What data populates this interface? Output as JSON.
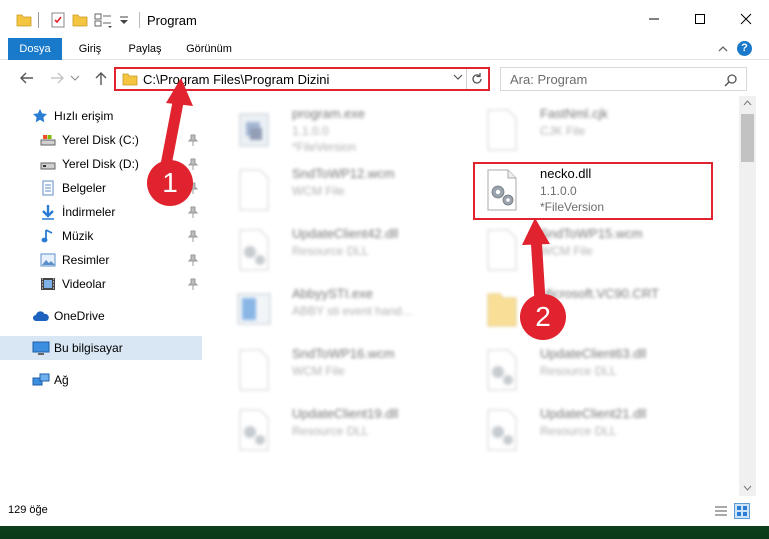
{
  "window": {
    "title": "Program"
  },
  "ribbon": {
    "tabs": [
      {
        "label": "Dosya"
      },
      {
        "label": "Giriş"
      },
      {
        "label": "Paylaş"
      },
      {
        "label": "Görünüm"
      }
    ],
    "help": "?"
  },
  "address": {
    "path": "C:\\Program Files\\Program Dizini",
    "search_placeholder": "Ara: Program"
  },
  "sidebar": {
    "items": [
      {
        "label": "Hızlı erişim",
        "icon": "star-icon"
      },
      {
        "label": "Yerel Disk (C:)",
        "icon": "drive-icon",
        "pinned": true
      },
      {
        "label": "Yerel Disk (D:)",
        "icon": "drive-icon",
        "pinned": true
      },
      {
        "label": "Belgeler",
        "icon": "documents-icon",
        "pinned": true
      },
      {
        "label": "İndirmeler",
        "icon": "download-icon",
        "pinned": true
      },
      {
        "label": "Müzik",
        "icon": "music-icon",
        "pinned": true
      },
      {
        "label": "Resimler",
        "icon": "pictures-icon",
        "pinned": true
      },
      {
        "label": "Videolar",
        "icon": "videos-icon",
        "pinned": true
      },
      {
        "label": "OneDrive",
        "icon": "onedrive-icon"
      },
      {
        "label": "Bu bilgisayar",
        "icon": "computer-icon",
        "selected": true
      },
      {
        "label": "Ağ",
        "icon": "network-icon"
      }
    ]
  },
  "files": [
    {
      "name": "program.exe",
      "desc": "1.1.0.0",
      "ver": "*FileVersion",
      "icon": "exe-icon",
      "blurred": true
    },
    {
      "name": "FastNml.cjk",
      "desc": "CJK File",
      "ver": "",
      "icon": "file-icon",
      "blurred": true
    },
    {
      "name": "SndToWP12.wcm",
      "desc": "WCM File",
      "ver": "",
      "icon": "file-icon",
      "blurred": true
    },
    {
      "name": "necko.dll",
      "desc": "1.1.0.0",
      "ver": "*FileVersion",
      "icon": "dll-icon",
      "blurred": false
    },
    {
      "name": "UpdateClient42.dll",
      "desc": "Resource DLL",
      "ver": "",
      "icon": "dll-icon",
      "blurred": true
    },
    {
      "name": "SndToWP15.wcm",
      "desc": "WCM File",
      "ver": "",
      "icon": "file-icon",
      "blurred": true
    },
    {
      "name": "AbbyySTI.exe",
      "desc": "ABBY sti event hand...",
      "ver": "",
      "icon": "exe-icon",
      "blurred": true
    },
    {
      "name": "Microsoft.VC90.CRT",
      "desc": "",
      "ver": "",
      "icon": "folder-icon",
      "blurred": true
    },
    {
      "name": "SndToWP16.wcm",
      "desc": "WCM File",
      "ver": "",
      "icon": "file-icon",
      "blurred": true
    },
    {
      "name": "UpdateClient63.dll",
      "desc": "Resource DLL",
      "ver": "",
      "icon": "dll-icon",
      "blurred": true
    },
    {
      "name": "UpdateClient19.dll",
      "desc": "Resource DLL",
      "ver": "",
      "icon": "dll-icon",
      "blurred": true
    },
    {
      "name": "UpdateClient21.dll",
      "desc": "Resource DLL",
      "ver": "",
      "icon": "dll-icon",
      "blurred": true
    }
  ],
  "status": {
    "item_count": "129 öğe"
  },
  "annotations": [
    {
      "label": "1"
    },
    {
      "label": "2"
    }
  ],
  "colors": {
    "accent": "#1979ca",
    "annotation_red": "#e0232e",
    "selected_bg": "#d9e7f5"
  }
}
